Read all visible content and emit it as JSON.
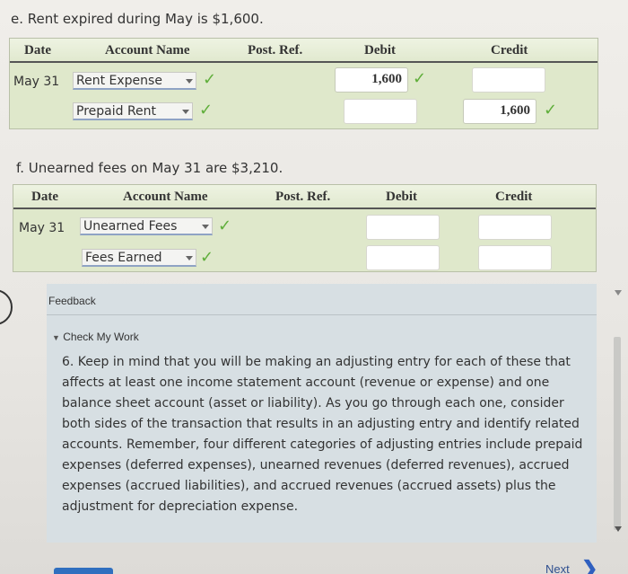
{
  "section_e": {
    "prompt": "e. Rent expired during May is $1,600.",
    "headers": {
      "date": "Date",
      "account": "Account Name",
      "post": "Post. Ref.",
      "debit": "Debit",
      "credit": "Credit"
    },
    "date": "May 31",
    "rows": [
      {
        "account": "Rent Expense",
        "debit": "1,600",
        "credit": ""
      },
      {
        "account": "Prepaid Rent",
        "debit": "",
        "credit": "1,600"
      }
    ]
  },
  "section_f": {
    "prompt": "f. Unearned fees on May 31 are $3,210.",
    "headers": {
      "date": "Date",
      "account": "Account Name",
      "post": "Post. Ref.",
      "debit": "Debit",
      "credit": "Credit"
    },
    "date": "May 31",
    "rows": [
      {
        "account": "Unearned Fees",
        "debit": "",
        "credit": ""
      },
      {
        "account": "Fees Earned",
        "debit": "",
        "credit": ""
      }
    ]
  },
  "feedback": {
    "title": "Feedback",
    "check_label": "Check My Work",
    "text": "6. Keep in mind that you will be making an adjusting entry for each of these that affects at least one income statement account (revenue or expense) and one balance sheet account (asset or liability). As you go through each one, consider both sides of the transaction that results in an adjusting entry and identify related accounts. Remember, four different categories of adjusting entries include prepaid expenses (deferred expenses), unearned revenues (deferred revenues), accrued expenses (accrued liabilities), and accrued revenues (accrued assets) plus the adjustment for depreciation expense."
  },
  "nav": {
    "next_label": "Next"
  },
  "colors": {
    "check": "#5fae3a",
    "table_bg": "#dfe8cb",
    "feedback_bg": "#d7dfe3"
  },
  "icons": {
    "check": "check-icon",
    "dropdown": "chevron-down-icon",
    "next": "chevron-right-icon"
  }
}
